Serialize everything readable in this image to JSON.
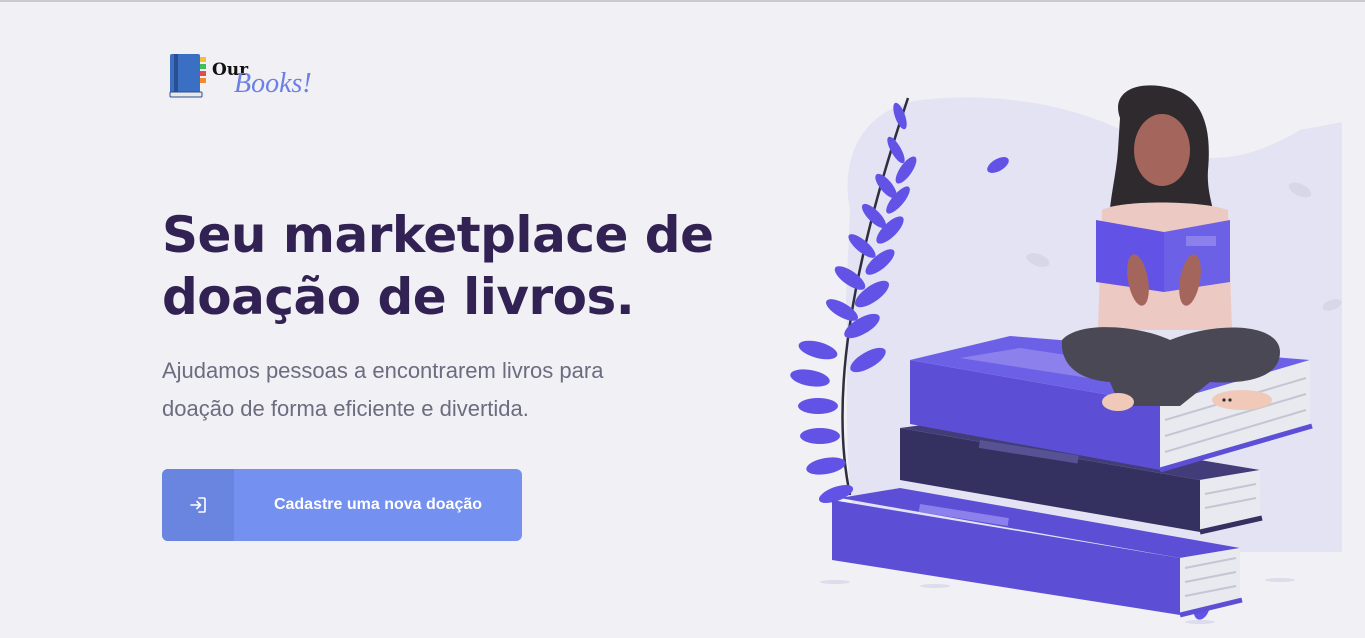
{
  "logo": {
    "word1": "Our",
    "word2": "Books!",
    "icon": "book-icon"
  },
  "hero": {
    "title": "Seu marketplace de doação de livros.",
    "subtitle": "Ajudamos pessoas a encontrarem livros para doação de forma eficiente e divertida."
  },
  "cta": {
    "label": "Cadastre uma nova doação",
    "icon": "sign-in-icon"
  },
  "illustration": {
    "name": "woman-reading-on-books"
  },
  "colors": {
    "background": "#f0f0f5",
    "title": "#322153",
    "subtitle": "#6c6c80",
    "button": "#7490f0",
    "button_icon_box": "#6a85e0",
    "books_primary": "#5c4fd6",
    "books_dark": "#34305f",
    "leaves": "#6253e6"
  }
}
